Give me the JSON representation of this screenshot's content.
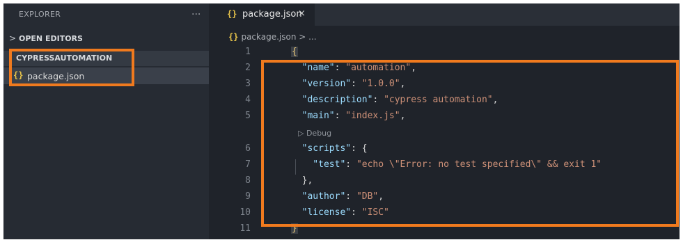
{
  "sidebar": {
    "title": "EXPLORER",
    "more_icon": "...",
    "sections": [
      {
        "label": "OPEN EDITORS",
        "chevron": ">"
      },
      {
        "label": "CYPRESSAUTOMATION"
      }
    ],
    "files": [
      {
        "icon": "{}",
        "name": "package.json"
      }
    ]
  },
  "editor": {
    "tab": {
      "icon": "{}",
      "label": "package.json",
      "close": "×"
    },
    "breadcrumb": {
      "icon": "{}",
      "text": "package.json > ..."
    },
    "codelens": "▷ Debug",
    "lines": [
      {
        "n": "1",
        "tokens": [
          {
            "t": "{",
            "c": "brace"
          }
        ]
      },
      {
        "n": "2",
        "tokens": [
          {
            "t": "  \"name\"",
            "c": "key"
          },
          {
            "t": ": ",
            "c": "punc"
          },
          {
            "t": "\"automation\"",
            "c": "str"
          },
          {
            "t": ",",
            "c": "punc"
          }
        ]
      },
      {
        "n": "3",
        "tokens": [
          {
            "t": "  \"version\"",
            "c": "key"
          },
          {
            "t": ": ",
            "c": "punc"
          },
          {
            "t": "\"1.0.0\"",
            "c": "str"
          },
          {
            "t": ",",
            "c": "punc"
          }
        ]
      },
      {
        "n": "4",
        "tokens": [
          {
            "t": "  \"description\"",
            "c": "key"
          },
          {
            "t": ": ",
            "c": "punc"
          },
          {
            "t": "\"cypress automation\"",
            "c": "str"
          },
          {
            "t": ",",
            "c": "punc"
          }
        ]
      },
      {
        "n": "5",
        "tokens": [
          {
            "t": "  \"main\"",
            "c": "key"
          },
          {
            "t": ": ",
            "c": "punc"
          },
          {
            "t": "\"index.js\"",
            "c": "str"
          },
          {
            "t": ",",
            "c": "punc"
          }
        ]
      },
      {
        "n": "6",
        "tokens": [
          {
            "t": "  \"scripts\"",
            "c": "key"
          },
          {
            "t": ": {",
            "c": "punc"
          }
        ]
      },
      {
        "n": "7",
        "tokens": [
          {
            "t": "    \"test\"",
            "c": "key"
          },
          {
            "t": ": ",
            "c": "punc"
          },
          {
            "t": "\"echo \\\"Error: no test specified\\\" && exit 1\"",
            "c": "str"
          }
        ]
      },
      {
        "n": "8",
        "tokens": [
          {
            "t": "  },",
            "c": "punc"
          }
        ]
      },
      {
        "n": "9",
        "tokens": [
          {
            "t": "  \"author\"",
            "c": "key"
          },
          {
            "t": ": ",
            "c": "punc"
          },
          {
            "t": "\"DB\"",
            "c": "str"
          },
          {
            "t": ",",
            "c": "punc"
          }
        ]
      },
      {
        "n": "10",
        "tokens": [
          {
            "t": "  \"license\"",
            "c": "key"
          },
          {
            "t": ": ",
            "c": "punc"
          },
          {
            "t": "\"ISC\"",
            "c": "str"
          }
        ]
      },
      {
        "n": "11",
        "tokens": [
          {
            "t": "}",
            "c": "brace"
          }
        ]
      }
    ]
  },
  "colors": {
    "highlight": "#f07a1e",
    "sidebar_bg": "#262b33",
    "editor_bg": "#1f232a",
    "json_key": "#9cdcfe",
    "json_string": "#ce9178",
    "file_icon": "#e6c34a"
  }
}
